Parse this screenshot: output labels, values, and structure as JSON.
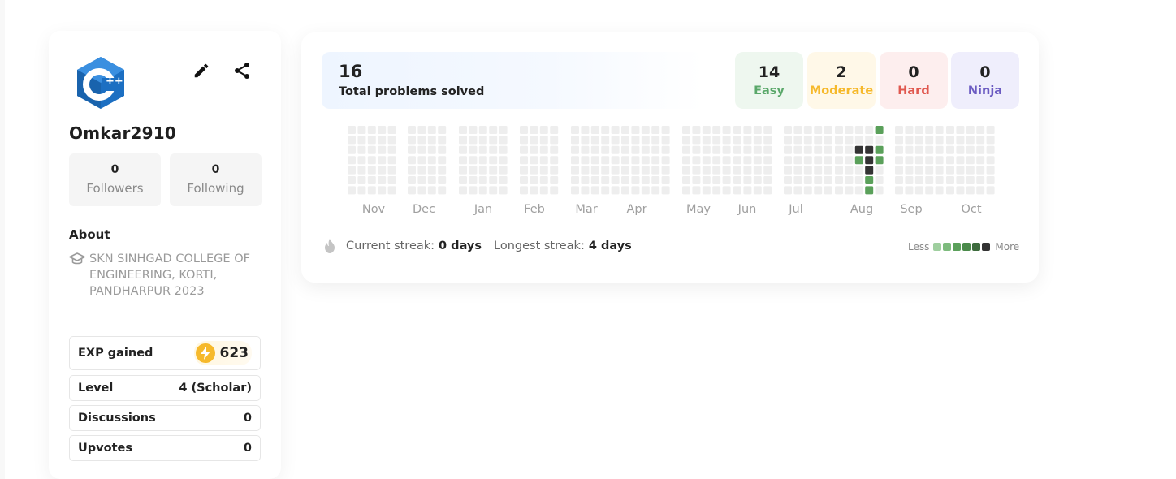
{
  "profile": {
    "avatar_icon": "cpp-logo-icon",
    "username": "Omkar2910",
    "followers": {
      "count": "0",
      "label": "Followers"
    },
    "following": {
      "count": "0",
      "label": "Following"
    },
    "about_title": "About",
    "college": "SKN SINHGAD COLLEGE OF ENGINEERING, KORTI, PANDHARPUR 2023",
    "stats": {
      "exp_label": "EXP gained",
      "exp_value": "623",
      "level_label": "Level",
      "level_value": "4 (Scholar)",
      "discussions_label": "Discussions",
      "discussions_value": "0",
      "upvotes_label": "Upvotes",
      "upvotes_value": "0"
    }
  },
  "problems": {
    "total": "16",
    "total_label": "Total problems solved",
    "difficulty": [
      {
        "count": "14",
        "label": "Easy",
        "color": "#5aa86a"
      },
      {
        "count": "2",
        "label": "Moderate",
        "color": "#f6b92b"
      },
      {
        "count": "0",
        "label": "Hard",
        "color": "#e0584f"
      },
      {
        "count": "0",
        "label": "Ninja",
        "color": "#6b5bc2"
      }
    ]
  },
  "heatmap": {
    "months": [
      "Nov",
      "Dec",
      "Jan",
      "Feb",
      "Mar",
      "Apr",
      "May",
      "Jun",
      "Jul",
      "Aug",
      "Sep",
      "Oct"
    ],
    "colors": {
      "empty": "#eeeeee",
      "levels": [
        "#9fcf9f",
        "#7dbb7d",
        "#5aa05a",
        "#4a8a4a",
        "#3d6b3d",
        "#333333"
      ]
    }
  },
  "streak": {
    "current_label": "Current streak:",
    "current_value": "0 days",
    "longest_label": "Longest streak:",
    "longest_value": "4 days"
  },
  "legend": {
    "less": "Less",
    "more": "More"
  }
}
